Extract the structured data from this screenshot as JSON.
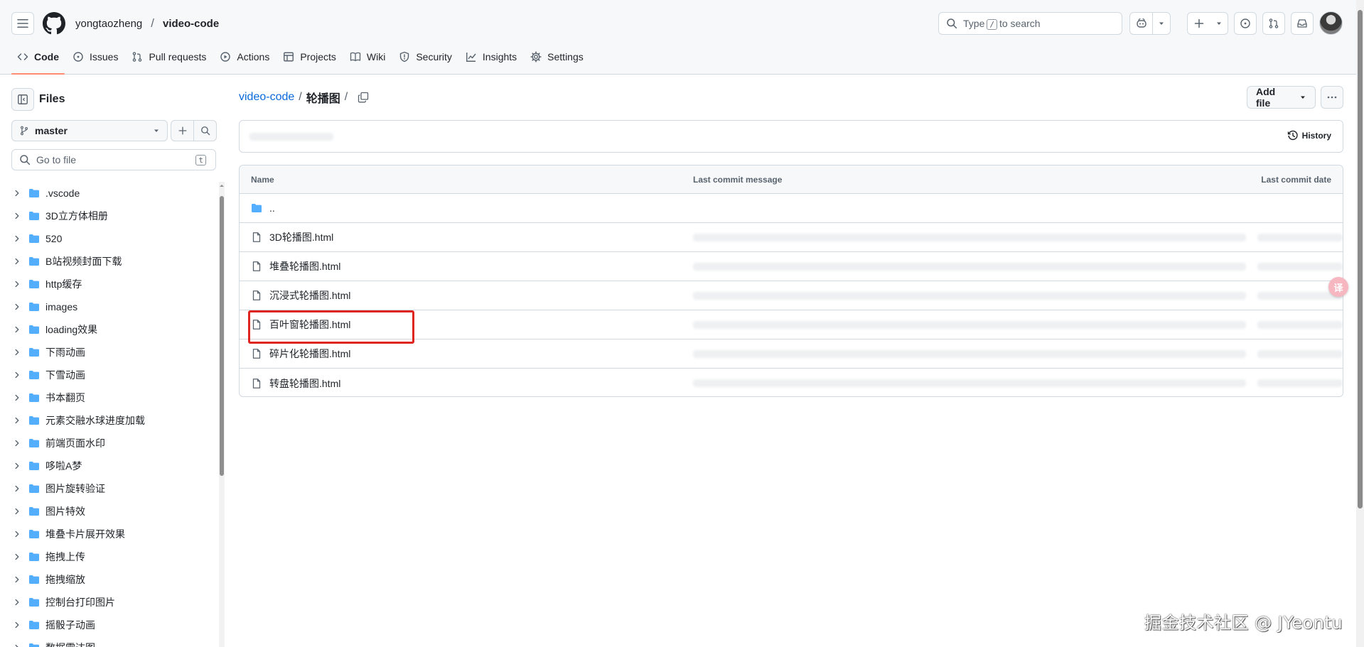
{
  "header": {
    "owner": "yongtaozheng",
    "separator": "/",
    "repo": "video-code",
    "search": {
      "prefix": "Type",
      "key": "/",
      "suffix": "to search"
    }
  },
  "nav": [
    {
      "id": "code",
      "label": "Code",
      "icon": "code-icon",
      "active": true
    },
    {
      "id": "issues",
      "label": "Issues",
      "icon": "issue-icon"
    },
    {
      "id": "pulls",
      "label": "Pull requests",
      "icon": "pull-request-icon"
    },
    {
      "id": "actions",
      "label": "Actions",
      "icon": "play-icon"
    },
    {
      "id": "projects",
      "label": "Projects",
      "icon": "table-icon"
    },
    {
      "id": "wiki",
      "label": "Wiki",
      "icon": "book-icon"
    },
    {
      "id": "security",
      "label": "Security",
      "icon": "shield-icon"
    },
    {
      "id": "insights",
      "label": "Insights",
      "icon": "graph-icon"
    },
    {
      "id": "settings",
      "label": "Settings",
      "icon": "gear-icon"
    }
  ],
  "sidebar": {
    "title": "Files",
    "branch": "master",
    "goto_placeholder": "Go to file",
    "goto_key": "t",
    "items": [
      ".vscode",
      "3D立方体相册",
      "520",
      "B站视频封面下载",
      "http缓存",
      "images",
      "loading效果",
      "下雨动画",
      "下雪动画",
      "书本翻页",
      "元素交融水球进度加载",
      "前端页面水印",
      "哆啦A梦",
      "图片旋转验证",
      "图片特效",
      "堆叠卡片展开效果",
      "拖拽上传",
      "拖拽缩放",
      "控制台打印图片",
      "摇骰子动画",
      "数据雷达图"
    ]
  },
  "main": {
    "breadcrumb_repo": "video-code",
    "breadcrumb_sep": "/",
    "breadcrumb_current": "轮播图",
    "breadcrumb_trailing": "/",
    "add_file": "Add file",
    "history": "History",
    "columns": {
      "name": "Name",
      "message": "Last commit message",
      "date": "Last commit date"
    },
    "parent_dir": "..",
    "files": [
      "3D轮播图.html",
      "堆叠轮播图.html",
      "沉浸式轮播图.html",
      "百叶窗轮播图.html",
      "碎片化轮播图.html",
      "转盘轮播图.html"
    ],
    "highlighted_file_index": 3
  },
  "colors": {
    "accent_link": "#0969da",
    "folder": "#54aeff",
    "active_tab_underline": "#fd8c73",
    "highlight_box": "#e0241f"
  },
  "overlay": {
    "translate_badge": "译",
    "watermark": "掘金技术社区 @ JYeontu"
  }
}
